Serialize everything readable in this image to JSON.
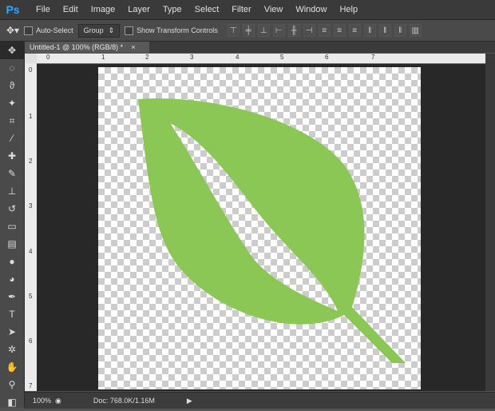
{
  "app": {
    "logo_text": "Ps",
    "menu": [
      "File",
      "Edit",
      "Image",
      "Layer",
      "Type",
      "Select",
      "Filter",
      "View",
      "Window",
      "Help"
    ]
  },
  "options": {
    "move_icon": "move-tool-icon",
    "auto_select_label": "Auto-Select",
    "group_value": "Group",
    "show_transform_label": "Show Transform Controls"
  },
  "document": {
    "tab_title": "Untitled-1 @ 100% (RGB/8) *",
    "close_glyph": "×",
    "zoom": "100%",
    "doc_info": "Doc: 768.0K/1.16M"
  },
  "rulers": {
    "top": [
      "1",
      "2",
      "3",
      "4",
      "5",
      "6",
      "7"
    ],
    "left": [
      "0",
      "1",
      "2",
      "3",
      "4",
      "5",
      "6",
      "7"
    ]
  },
  "colors": {
    "leaf": "#8bc755",
    "accent": "#31a8ff"
  }
}
